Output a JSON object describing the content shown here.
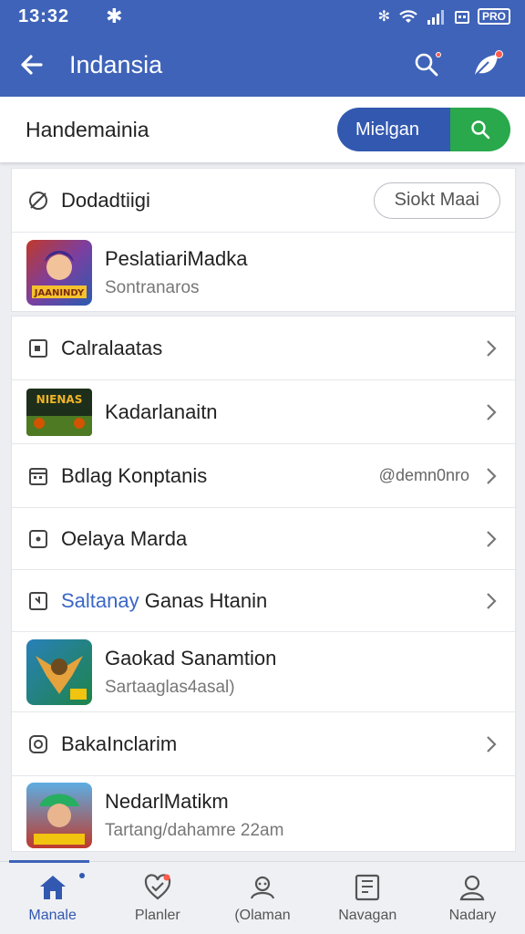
{
  "status_bar": {
    "time": "13:32",
    "battery": "PRO"
  },
  "app_bar": {
    "title": "Indansia"
  },
  "search": {
    "value": "Handemainia",
    "button_label": "Mielgan"
  },
  "card1": {
    "header_label": "Dodadtiigi",
    "header_button": "Siokt Maai",
    "item": {
      "title": "PeslatiariMadka",
      "subtitle": "Sontranaros",
      "thumb_text": "JAANINDY"
    }
  },
  "list": {
    "row1": {
      "label": "Calralaatas"
    },
    "row2": {
      "label": "Kadarlanaitn",
      "thumb_text": "NIENAS"
    },
    "row3": {
      "label": "Bdlag Konptanis",
      "side": "@demn0nro"
    },
    "row4": {
      "label": "Oelaya Marda"
    },
    "row5": {
      "label_blue": "Saltanay",
      "label_rest": " Ganas Htanin"
    },
    "row6": {
      "title": "Gaokad Sanamtion",
      "subtitle": "Sartaaglas4asal)"
    },
    "row7": {
      "label": "BakaInclarim"
    },
    "row8": {
      "title": "NedarlMatikm",
      "subtitle": "Tartang/dahamre 22am"
    }
  },
  "nav": [
    {
      "label": "Manale"
    },
    {
      "label": "Planler"
    },
    {
      "label": "(Olaman"
    },
    {
      "label": "Navagan"
    },
    {
      "label": "Nadary"
    }
  ]
}
